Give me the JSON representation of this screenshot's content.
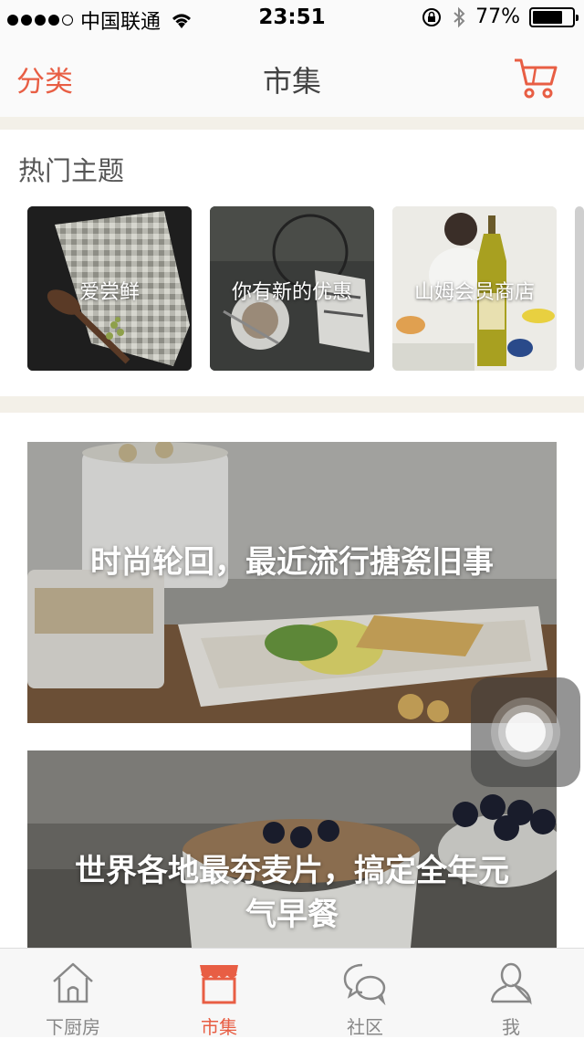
{
  "status_bar": {
    "carrier": "中国联通",
    "time": "23:51",
    "battery": "77%",
    "battery_level": 0.77
  },
  "nav": {
    "left_label": "分类",
    "title": "市集",
    "cart_icon": "cart-icon"
  },
  "hot_topics": {
    "heading": "热门主题",
    "items": [
      {
        "label": "爱尝鲜"
      },
      {
        "label": "你有新的优惠"
      },
      {
        "label": "山姆会员商店"
      }
    ]
  },
  "features": [
    {
      "title": "时尚轮回，最近流行搪瓷旧事"
    },
    {
      "title": "世界各地最夯麦片，搞定全年元气早餐"
    }
  ],
  "tabs": [
    {
      "label": "下厨房",
      "icon": "house-icon"
    },
    {
      "label": "市集",
      "icon": "shop-icon"
    },
    {
      "label": "社区",
      "icon": "chat-bubbles-icon"
    },
    {
      "label": "我",
      "icon": "person-icon"
    }
  ],
  "active_tab": "市集",
  "colors": {
    "accent": "#e85e44",
    "separator": "#f3f0e8"
  }
}
